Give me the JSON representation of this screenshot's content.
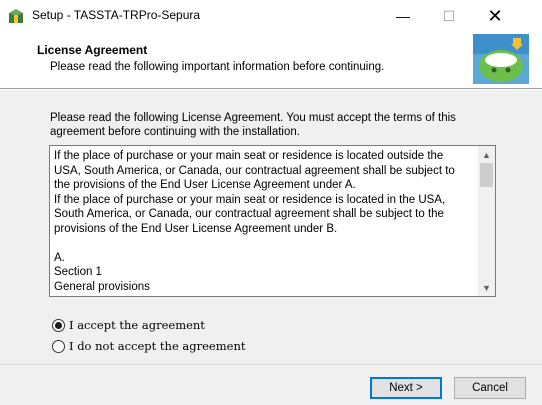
{
  "window": {
    "title": "Setup - TASSTA-TRPro-Sepura",
    "minimize_glyph": "—",
    "maximize_glyph": "☐",
    "close_glyph": "✕"
  },
  "header": {
    "title": "License Agreement",
    "subtitle": "Please read the following important information before continuing."
  },
  "intro": "Please read the following License Agreement. You must accept the terms of this agreement before continuing with the installation.",
  "license_text": "If the place of purchase or your main seat or residence is located outside the\nUSA, South America, or Canada, our contractual agreement shall be subject to\nthe provisions of the End User License Agreement under A.\nIf the place of purchase or your main seat or residence is located in the USA,\nSouth America, or Canada, our contractual agreement shall be subject to the\nprovisions of the End User License Agreement under B.\n\nA.\nSection 1\nGeneral provisions",
  "scrollbar": {
    "up_glyph": "▲",
    "down_glyph": "▼"
  },
  "radios": {
    "accept_label": "I accept the agreement",
    "decline_label": "I do not accept the agreement",
    "selected": "accept"
  },
  "buttons": {
    "next_label": "Next >",
    "cancel_label": "Cancel"
  },
  "icons": {
    "app_icon": "installer-box-icon",
    "header_art": "setup-wizard-image"
  }
}
